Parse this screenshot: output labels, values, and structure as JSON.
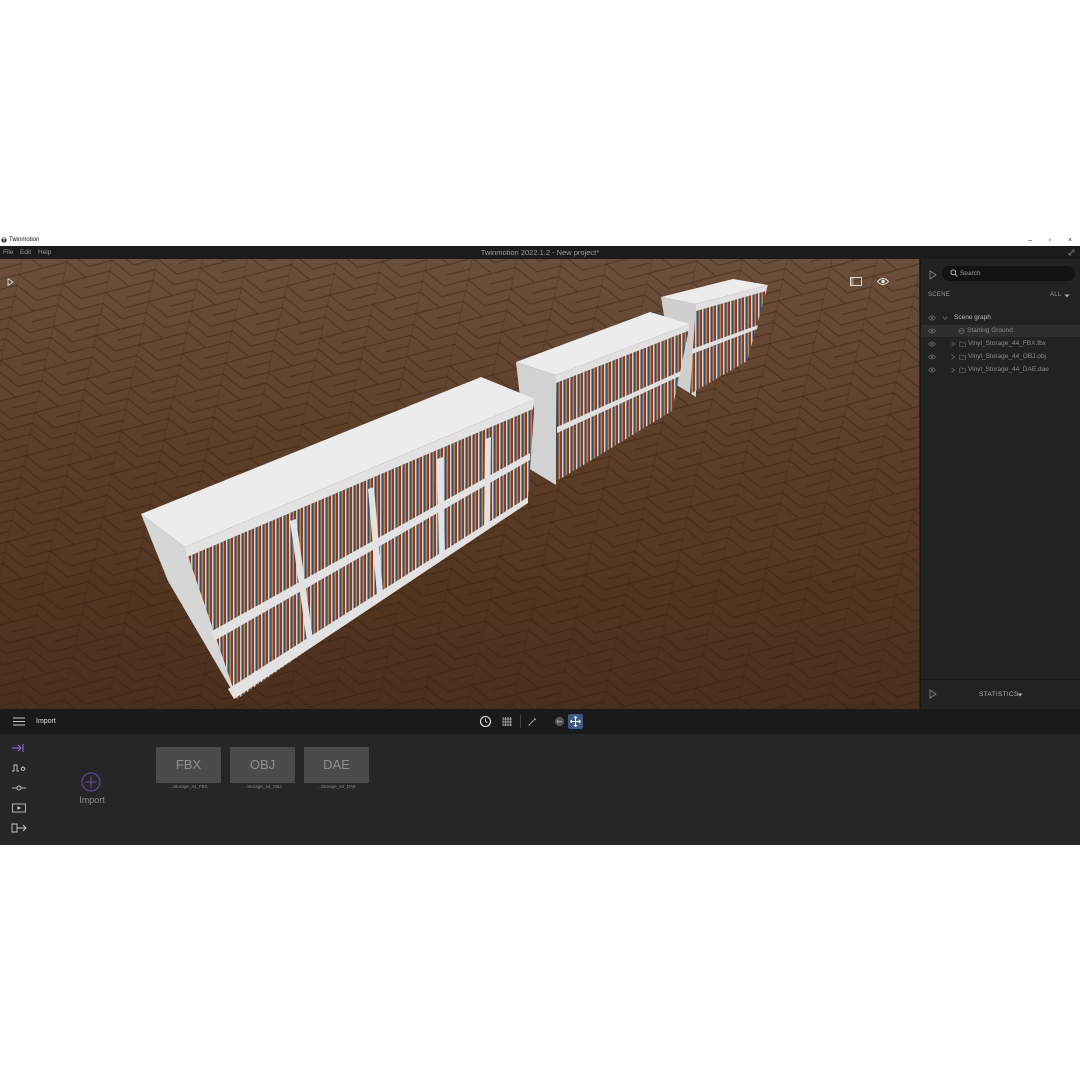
{
  "os": {
    "app_name": "Twinmotion",
    "minimize": "–",
    "maximize": "▫",
    "close": "×"
  },
  "menu": {
    "items": [
      "File",
      "Edit",
      "Help"
    ],
    "title": "Twinmotion 2022.1.2 - New project*"
  },
  "scene_panel": {
    "search_placeholder": "Search",
    "section_label": "SCENE",
    "filter_label": "ALL",
    "tree": [
      {
        "label": "Scene graph"
      },
      {
        "label": "Starting Ground"
      },
      {
        "label": "Vinyl_Storage_44_FBX.fbx"
      },
      {
        "label": "Vinyl_Storage_44_OBJ.obj"
      },
      {
        "label": "Vinyl_Storage_44_DAE.dae"
      }
    ],
    "footer_label": "STATISTICS"
  },
  "toolbar": {
    "mode_label": "Import"
  },
  "import_panel": {
    "import_label": "Import",
    "assets": [
      {
        "thumb_label": "FBX",
        "name": "...Storage_44_FBX"
      },
      {
        "thumb_label": "OBJ",
        "name": "...Storage_44_OBJ"
      },
      {
        "thumb_label": "DAE",
        "name": "...Storage_44_DAE"
      }
    ]
  },
  "colors": {
    "accent": "#7b5cd6",
    "active_tool": "#3d5a80",
    "floor": "#5a3b26",
    "shelf": "#e6e6e6"
  }
}
